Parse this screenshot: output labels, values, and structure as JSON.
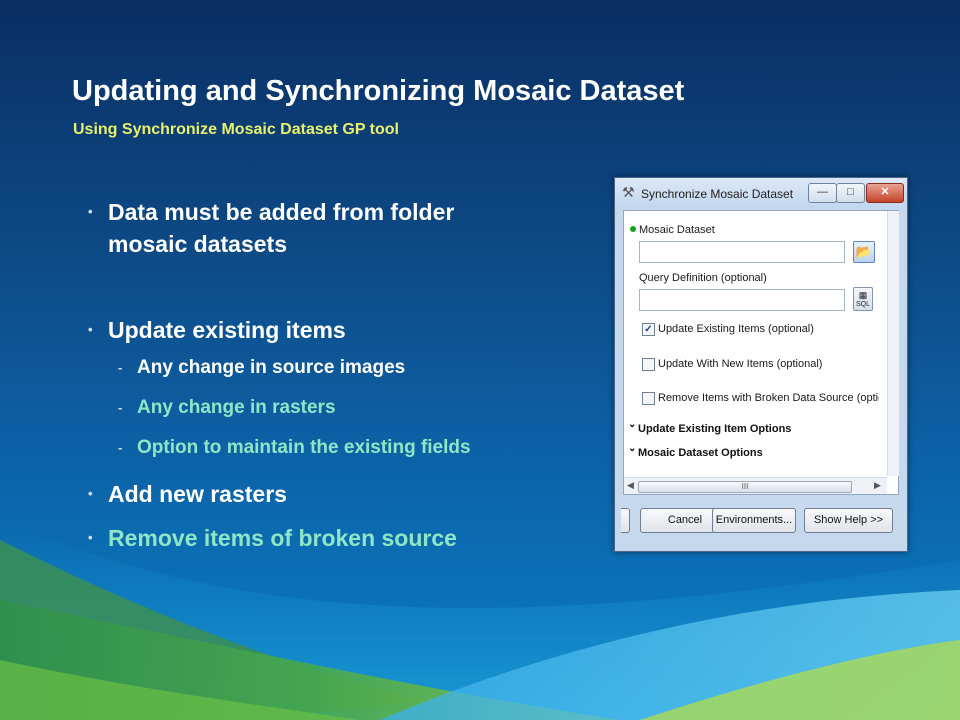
{
  "slide": {
    "title": "Updating and Synchronizing Mosaic Dataset",
    "subtitle": "Using Synchronize Mosaic Dataset GP tool",
    "colors": {
      "title": "#ffffff",
      "subtitle": "#e9f06a",
      "bullet_white": "#ffffff",
      "bullet_green": "#8ee6c6"
    }
  },
  "bullets": [
    {
      "text": "Data must be added from folder mosaic datasets"
    },
    {
      "text": "Update existing items"
    },
    {
      "text": "Add new rasters"
    },
    {
      "text": "Remove items of broken source"
    }
  ],
  "sub_bullets": [
    {
      "text": "Any change in source images"
    },
    {
      "text": "Any change in rasters"
    },
    {
      "text": "Option to maintain the existing fields"
    }
  ],
  "dialog": {
    "title": "Synchronize Mosaic Dataset",
    "title_icon": "hammer-icon",
    "params": {
      "mosaic_dataset_label": "Mosaic Dataset",
      "mosaic_dataset_value": "",
      "query_definition_label": "Query Definition (optional)",
      "query_definition_value": "",
      "sql_button_label": "SQL"
    },
    "checkboxes": [
      {
        "label": "Update Existing Items (optional)",
        "checked": true
      },
      {
        "label": "Update With New Items (optional)",
        "checked": false
      },
      {
        "label": "Remove Items with Broken Data Source (optic",
        "checked": false
      }
    ],
    "sections": [
      {
        "label": "Update Existing Item Options"
      },
      {
        "label": "Mosaic Dataset Options"
      }
    ],
    "scroll_thumb_glyph": "III",
    "buttons": {
      "cancel": "Cancel",
      "environments": "Environments...",
      "show_help": "Show Help >>"
    }
  }
}
